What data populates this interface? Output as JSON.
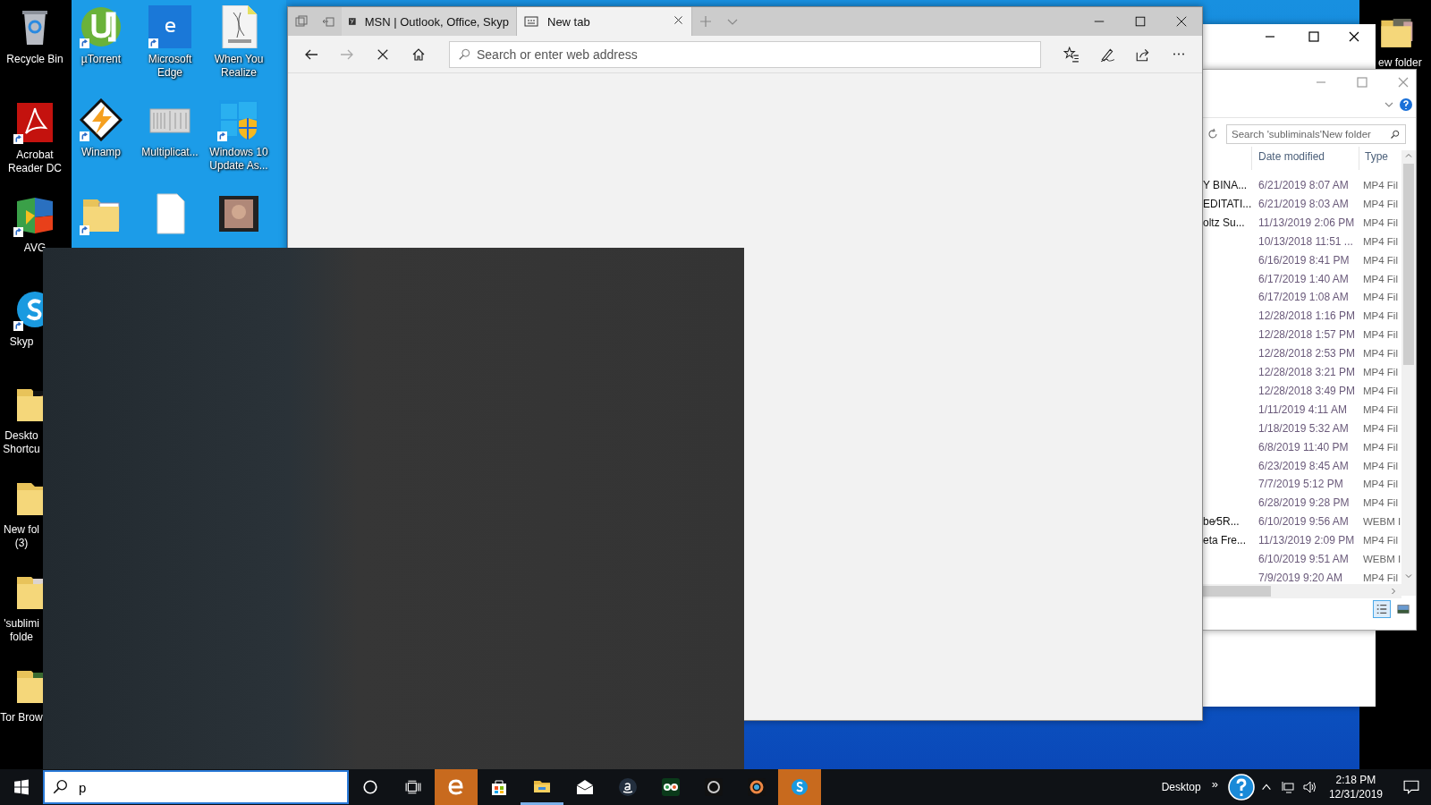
{
  "desktop": {
    "left_icons": [
      {
        "label": "Recycle Bin"
      },
      {
        "label": "Acrobat Reader DC"
      },
      {
        "label": "AVG"
      },
      {
        "label": "Skyp"
      },
      {
        "label": "Deskto Shortcu"
      },
      {
        "label": "New fol (3)"
      },
      {
        "label": "'sublimi folde"
      },
      {
        "label": "Tor Brow"
      }
    ],
    "grid_icons": [
      {
        "label": "µTorrent"
      },
      {
        "label": "Microsoft Edge"
      },
      {
        "label": "When You Realize"
      },
      {
        "label": "Winamp"
      },
      {
        "label": "Multiplicat..."
      },
      {
        "label": "Windows 10 Update As..."
      }
    ],
    "right_icons": [
      {
        "label": "ew folder"
      }
    ]
  },
  "browser": {
    "tabs": [
      {
        "label": "MSN | Outlook, Office, Skyp",
        "selected": false
      },
      {
        "label": "New tab",
        "selected": true
      }
    ],
    "forward_disabled": true,
    "address_bar": {
      "placeholder": "Search or enter web address"
    }
  },
  "explorer": {
    "search": {
      "placeholder": "Search 'subliminals'New folder"
    },
    "columns": [
      "Date modified",
      "Type"
    ],
    "rows": [
      {
        "column_1": "Y BINA...",
        "date_modified": "6/21/2019 8:07 AM",
        "type": "MP4 Fil"
      },
      {
        "column_1": "EDITATI...",
        "date_modified": "6/21/2019 8:03 AM",
        "type": "MP4 Fil"
      },
      {
        "column_1": "oltz Su...",
        "date_modified": "11/13/2019 2:06 PM",
        "type": "MP4 Fil"
      },
      {
        "date_modified": "10/13/2018 11:51 ...",
        "type": "MP4 Fil"
      },
      {
        "date_modified": "6/16/2019 8:41 PM",
        "type": "MP4 Fil"
      },
      {
        "date_modified": "6/17/2019 1:40 AM",
        "type": "MP4 Fil"
      },
      {
        "date_modified": "6/17/2019 1:08 AM",
        "type": "MP4 Fil"
      },
      {
        "date_modified": "12/28/2018 1:16 PM",
        "type": "MP4 Fil"
      },
      {
        "date_modified": "12/28/2018 1:57 PM",
        "type": "MP4 Fil"
      },
      {
        "date_modified": "12/28/2018 2:53 PM",
        "type": "MP4 Fil"
      },
      {
        "date_modified": "12/28/2018 3:21 PM",
        "type": "MP4 Fil"
      },
      {
        "date_modified": "12/28/2018 3:49 PM",
        "type": "MP4 Fil"
      },
      {
        "date_modified": "1/11/2019 4:11 AM",
        "type": "MP4 Fil"
      },
      {
        "date_modified": "1/18/2019 5:32 AM",
        "type": "MP4 Fil"
      },
      {
        "date_modified": "6/8/2019 11:40 PM",
        "type": "MP4 Fil"
      },
      {
        "date_modified": "6/23/2019 8:45 AM",
        "type": "MP4 Fil"
      },
      {
        "date_modified": "7/7/2019 5:12 PM",
        "type": "MP4 Fil"
      },
      {
        "date_modified": "6/28/2019 9:28 PM",
        "type": "MP4 Fil"
      },
      {
        "column_1": "be∕5R...",
        "date_modified": "6/10/2019 9:56 AM",
        "type": "WEBM I"
      },
      {
        "column_1": "eta Fre...",
        "date_modified": "11/13/2019 2:09 PM",
        "type": "MP4 Fil"
      },
      {
        "date_modified": "6/10/2019 9:51 AM",
        "type": "WEBM I"
      },
      {
        "date_modified": "7/9/2019 9:20 AM",
        "type": "MP4 Fil"
      }
    ],
    "view_buttons": [
      {
        "selected": true
      },
      {
        "selected": false
      }
    ]
  },
  "taskbar": {
    "search": {
      "value": "p"
    },
    "apps": [
      {
        "highlighted": true,
        "open": false
      },
      {
        "highlighted": false,
        "open": false
      },
      {
        "highlighted": false,
        "open": true
      },
      {
        "highlighted": false,
        "open": false
      },
      {
        "highlighted": false,
        "open": false
      },
      {
        "highlighted": false,
        "open": false
      },
      {
        "highlighted": false,
        "open": false
      },
      {
        "highlighted": false,
        "open": false
      },
      {
        "highlighted": true,
        "open": false
      }
    ],
    "toolbar_label": "Desktop",
    "toolbar_overflow": "»",
    "time": "2:18 PM",
    "date": "12/31/2019"
  }
}
